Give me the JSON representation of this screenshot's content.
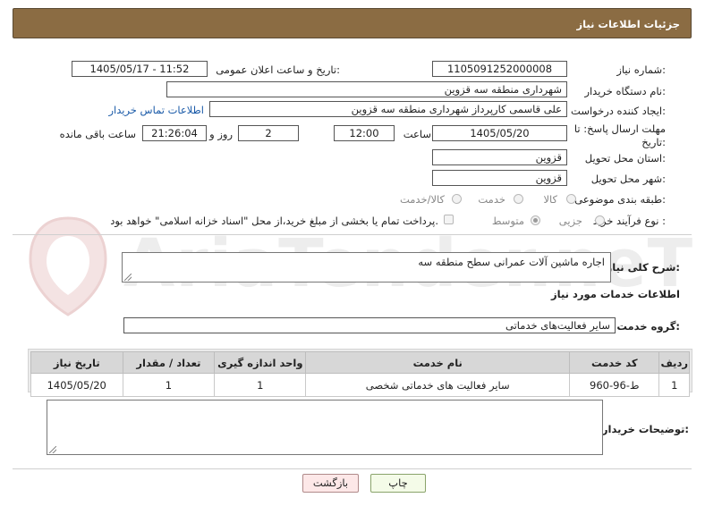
{
  "header": {
    "title": "جزئیات اطلاعات نیاز"
  },
  "watermark": {
    "text": "AriaTender.neT"
  },
  "fields": {
    "need_number_label": "شماره نیاز:",
    "need_number": "1105091252000008",
    "announce_label": "تاریخ و ساعت اعلان عمومی:",
    "announce_value": "1405/05/17 - 11:52",
    "buyer_org_label": "نام دستگاه خریدار:",
    "buyer_org": "شهرداری منطقه سه قزوین",
    "creator_label": "ایجاد کننده درخواست:",
    "creator": "علی قاسمی کارپرداز شهرداری منطقه سه قزوین",
    "contact_link": "اطلاعات تماس خریدار",
    "deadline_label_1": "مهلت ارسال پاسخ: تا",
    "deadline_label_2": "تاریخ:",
    "deadline_date": "1405/05/20",
    "time_label": "ساعت",
    "deadline_time": "12:00",
    "days_value": "2",
    "days_label": "روز و",
    "remaining_time": "21:26:04",
    "remaining_label": "ساعت باقی مانده",
    "province_label": "استان محل تحویل:",
    "province": "قزوین",
    "city_label": "شهر محل تحویل:",
    "city": "قزوین",
    "category_label": "طبقه بندی موضوعی:",
    "category_options": [
      "کالا",
      "خدمت",
      "کالا/خدمت"
    ],
    "purchase_type_label": "نوع فرآیند خرید :",
    "purchase_options": [
      "جزیی",
      "متوسط"
    ],
    "payment_note": "پرداخت تمام یا بخشی از مبلغ خرید،از محل \"اسناد خزانه اسلامی\" خواهد بود."
  },
  "summary": {
    "label": "شرح کلی نیاز:",
    "text": "اجاره ماشین آلات عمرانی سطح منطقه سه"
  },
  "services": {
    "heading": "اطلاعات خدمات مورد نیاز",
    "group_label": "گروه خدمت:",
    "group_value": "سایر فعالیت‌های خدماتی",
    "columns": [
      "ردیف",
      "کد خدمت",
      "نام خدمت",
      "واحد اندازه گیری",
      "تعداد / مقدار",
      "تاریخ نیاز"
    ],
    "rows": [
      [
        "1",
        "ط-96-960",
        "سایر فعالیت های خدماتی شخصی",
        "1",
        "1",
        "1405/05/20"
      ]
    ]
  },
  "buyer_notes": {
    "label": "توضیحات خریدار:"
  },
  "buttons": {
    "print": "چاپ",
    "back": "بازگشت"
  }
}
